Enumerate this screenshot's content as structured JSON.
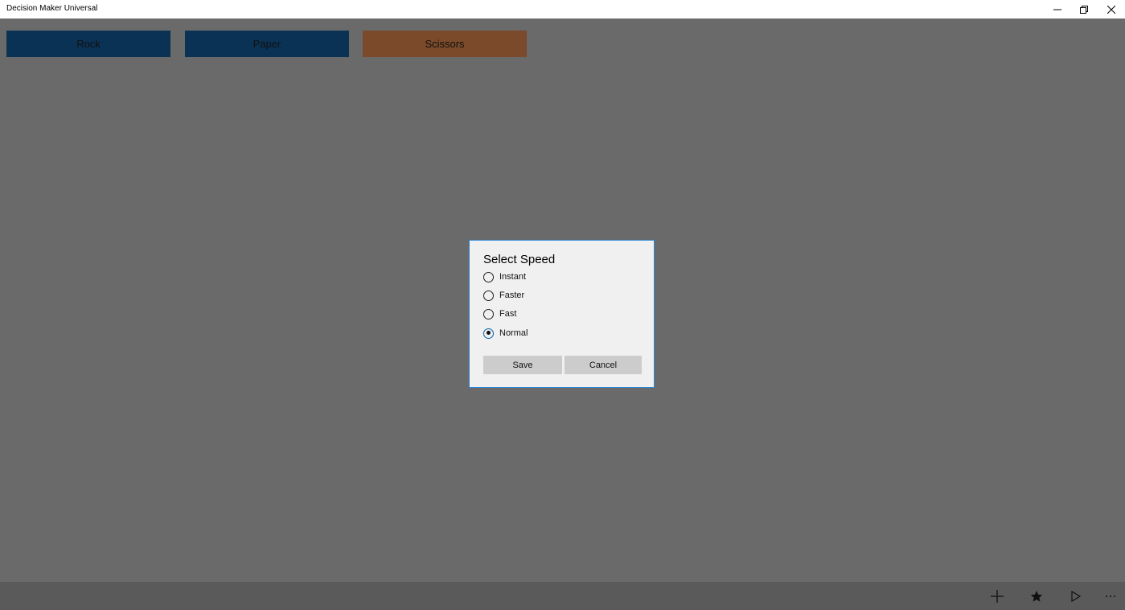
{
  "window": {
    "title": "Decision Maker Universal",
    "controls": [
      {
        "name": "minimize-icon"
      },
      {
        "name": "restore-icon"
      },
      {
        "name": "close-icon"
      }
    ]
  },
  "choices": [
    {
      "label": "Rock",
      "color": "#0a3255"
    },
    {
      "label": "Paper",
      "color": "#0a3255"
    },
    {
      "label": "Scissors",
      "color": "#7a4a2a"
    }
  ],
  "dialog": {
    "title": "Select Speed",
    "options": [
      {
        "label": "Instant",
        "selected": false
      },
      {
        "label": "Faster",
        "selected": false
      },
      {
        "label": "Fast",
        "selected": false
      },
      {
        "label": "Normal",
        "selected": true
      }
    ],
    "save_label": "Save",
    "cancel_label": "Cancel",
    "accent": "#2b88d8"
  },
  "appbar": {
    "buttons": [
      {
        "icon": "add-icon"
      },
      {
        "icon": "star-icon"
      },
      {
        "icon": "play-icon"
      },
      {
        "icon": "more-icon"
      }
    ]
  }
}
